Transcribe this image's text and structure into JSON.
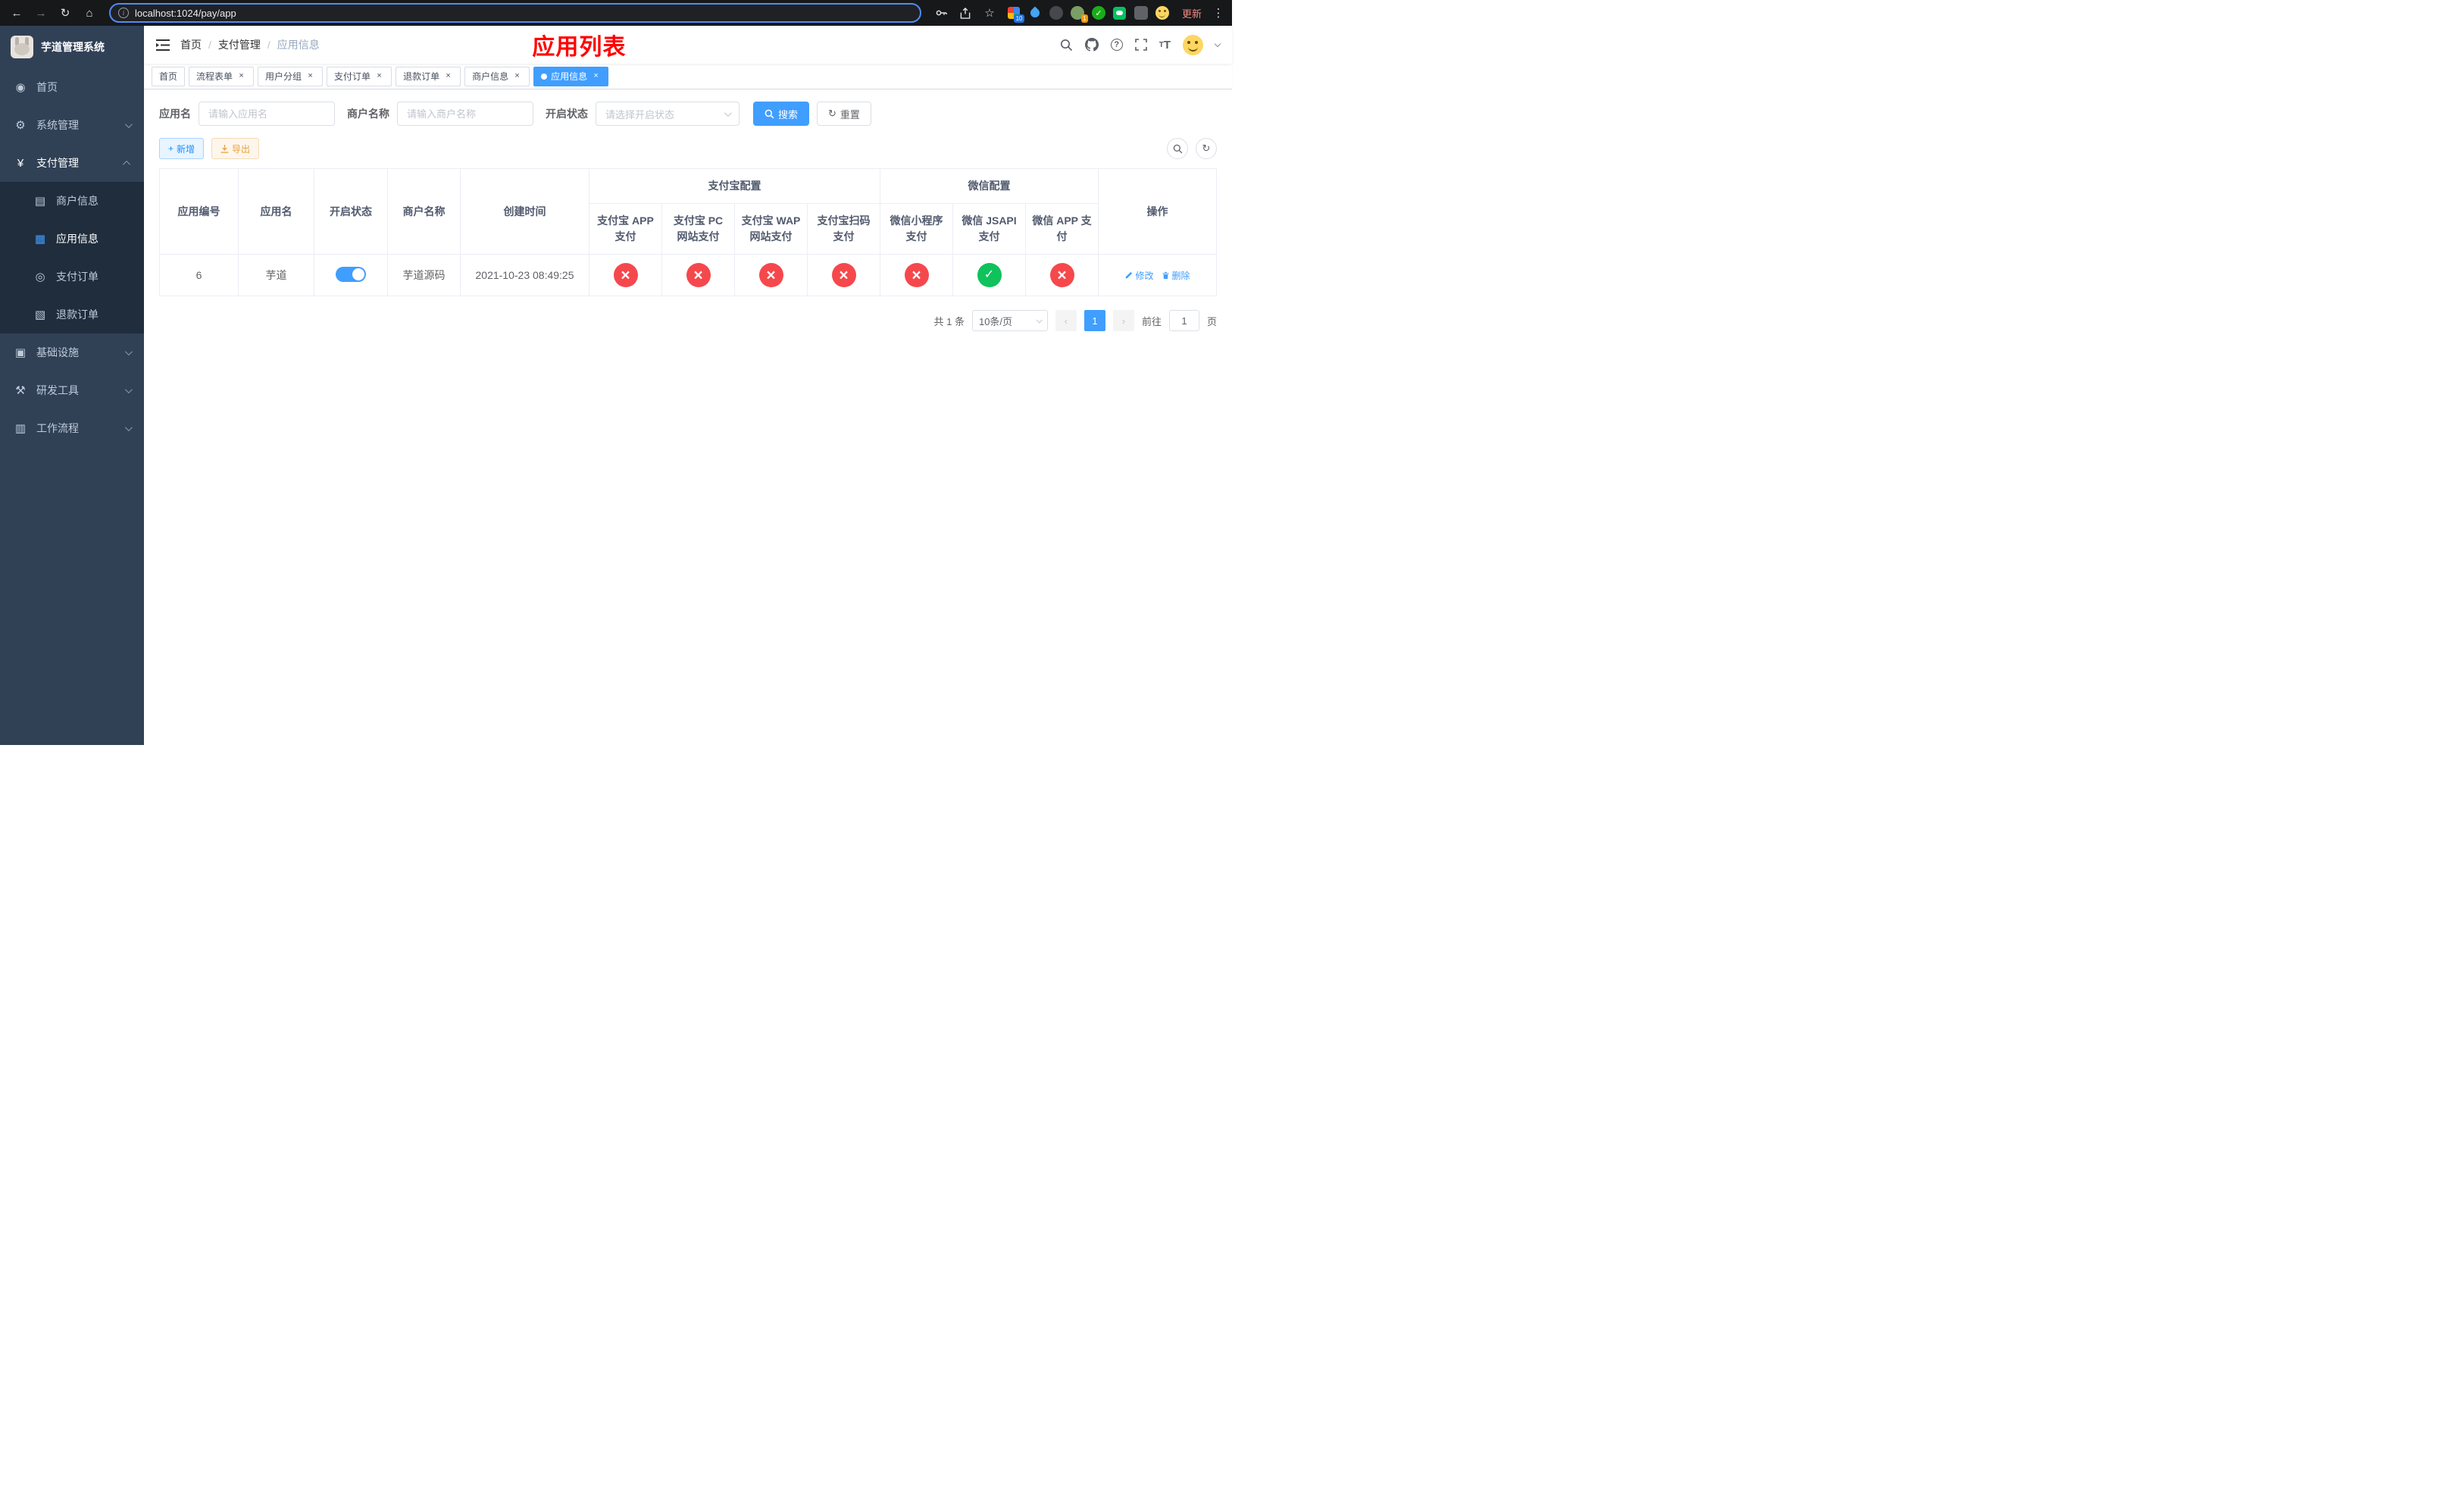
{
  "browser": {
    "url": "localhost:1024/pay/app",
    "update_label": "更新",
    "extensions_badge": "10",
    "avatar_ext_badge": "1"
  },
  "sidebar": {
    "title": "芋道管理系统",
    "items": [
      {
        "label": "首页",
        "icon": "dashboard-icon",
        "glyph": "◉"
      },
      {
        "label": "系统管理",
        "icon": "gear-icon",
        "glyph": "⚙"
      },
      {
        "label": "支付管理",
        "icon": "yen-icon",
        "glyph": "¥"
      },
      {
        "label": "基础设施",
        "icon": "infra-icon",
        "glyph": "▣"
      },
      {
        "label": "研发工具",
        "icon": "devtools-icon",
        "glyph": "⚒"
      },
      {
        "label": "工作流程",
        "icon": "workflow-icon",
        "glyph": "▥"
      }
    ],
    "payment_children": [
      {
        "label": "商户信息",
        "icon": "merchant-icon",
        "glyph": "▤"
      },
      {
        "label": "应用信息",
        "icon": "app-grid-icon",
        "glyph": "▦"
      },
      {
        "label": "支付订单",
        "icon": "pay-order-icon",
        "glyph": "◎"
      },
      {
        "label": "退款订单",
        "icon": "refund-order-icon",
        "glyph": "▧"
      }
    ]
  },
  "navbar": {
    "breadcrumb": [
      "首页",
      "支付管理",
      "应用信息"
    ],
    "annotation": "应用列表"
  },
  "tabs": [
    {
      "label": "首页"
    },
    {
      "label": "流程表单"
    },
    {
      "label": "用户分组"
    },
    {
      "label": "支付订单"
    },
    {
      "label": "退款订单"
    },
    {
      "label": "商户信息"
    },
    {
      "label": "应用信息"
    }
  ],
  "filters": {
    "app_name_label": "应用名",
    "app_name_placeholder": "请输入应用名",
    "merchant_label": "商户名称",
    "merchant_placeholder": "请输入商户名称",
    "status_label": "开启状态",
    "status_placeholder": "请选择开启状态",
    "search_label": "搜索",
    "reset_label": "重置"
  },
  "toolbar": {
    "add_label": "新增",
    "export_label": "导出"
  },
  "table": {
    "headers": {
      "app_id": "应用编号",
      "app_name": "应用名",
      "status": "开启状态",
      "merchant": "商户名称",
      "created": "创建时间",
      "alipay_group": "支付宝配置",
      "alipay_children": [
        "支付宝 APP 支付",
        "支付宝 PC 网站支付",
        "支付宝 WAP 网站支付",
        "支付宝扫码支付"
      ],
      "wechat_group": "微信配置",
      "wechat_children": [
        "微信小程序支付",
        "微信 JSAPI 支付",
        "微信 APP 支付"
      ],
      "actions": "操作"
    },
    "rows": [
      {
        "app_id": "6",
        "app_name": "芋道",
        "enabled": true,
        "merchant": "芋道源码",
        "created": "2021-10-23 08:49:25",
        "configs": [
          "disabled",
          "disabled",
          "disabled",
          "disabled",
          "disabled",
          "enabled",
          "disabled"
        ],
        "edit_label": "修改",
        "delete_label": "删除"
      }
    ]
  },
  "pagination": {
    "total": "共 1 条",
    "page_size": "10条/页",
    "current_page": "1",
    "goto_label": "前往",
    "goto_value": "1",
    "goto_suffix": "页"
  },
  "colors": {
    "primary": "#409eff",
    "danger": "#f5484d",
    "success": "#0fc25b",
    "annotation_red": "#ff0000",
    "sidebar_bg": "#304156",
    "submenu_bg": "#1f2d3d"
  }
}
